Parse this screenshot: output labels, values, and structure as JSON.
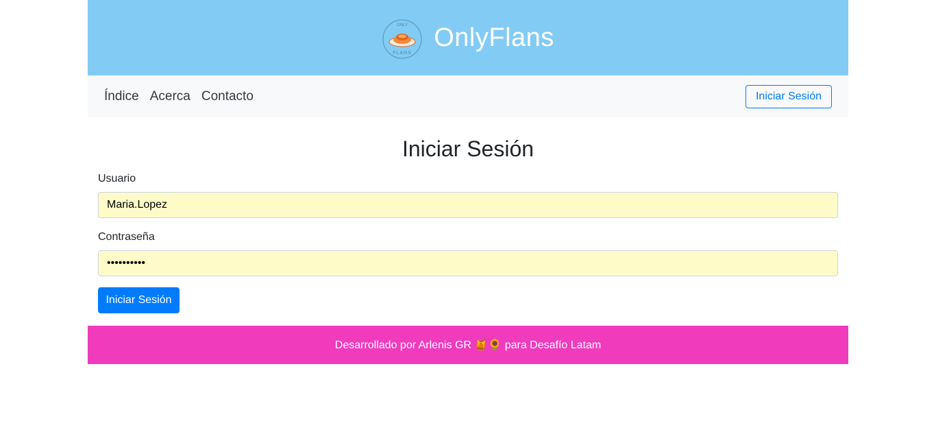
{
  "colors": {
    "header_bg": "#82cbf4",
    "navbar_bg": "#f8f9fa",
    "primary": "#007bff",
    "footer_bg": "#f03bbd",
    "autofill_bg": "#fefbc8"
  },
  "header": {
    "logo_icon": "flan-logo-icon",
    "logo_text_top": "ONLY",
    "logo_text_bottom": "FLANS",
    "brand": "OnlyFlans"
  },
  "nav": {
    "items": [
      "Índice",
      "Acerca",
      "Contacto"
    ],
    "login_label": "Iniciar Sesión"
  },
  "form": {
    "title": "Iniciar Sesión",
    "username_label": "Usuario",
    "username_value": "Maria.Lopez",
    "password_label": "Contraseña",
    "password_value": "••••••••••",
    "submit_label": "Iniciar Sesión"
  },
  "footer": {
    "text": "Desarrollado por Arlenis GR 🍯🌻 para Desafío Latam"
  }
}
